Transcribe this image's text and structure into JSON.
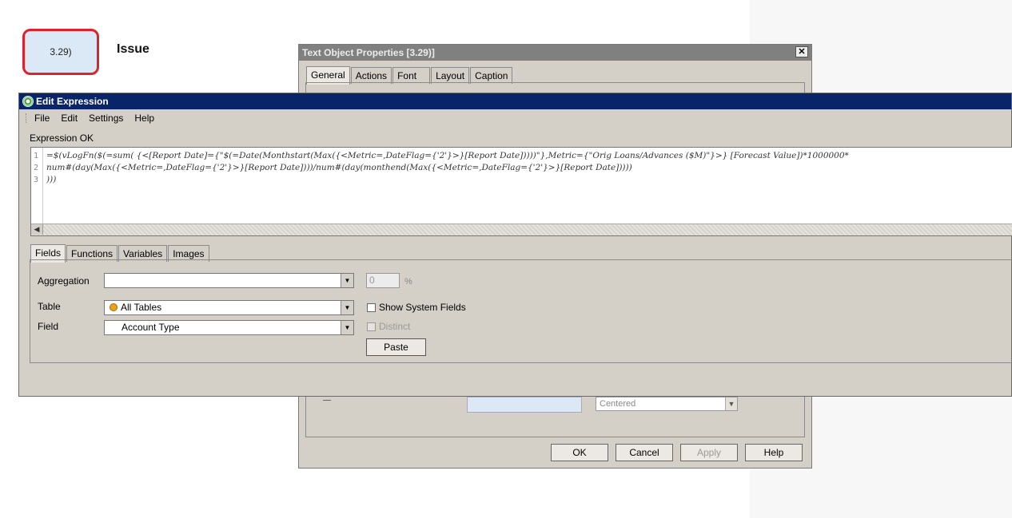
{
  "callout": {
    "label": "3.29)",
    "heading": "Issue"
  },
  "text_props": {
    "title": "Text Object Properties [3.29)]",
    "close": "✕",
    "tabs": [
      "General",
      "Actions",
      "Font",
      "Layout",
      "Caption"
    ],
    "alignment_value": "Centered",
    "buttons": {
      "ok": "OK",
      "cancel": "Cancel",
      "apply": "Apply",
      "help": "Help"
    }
  },
  "edit_expr": {
    "title": "Edit Expression",
    "menu": [
      "File",
      "Edit",
      "Settings",
      "Help"
    ],
    "status": "Expression OK",
    "lines": [
      {
        "num": "1",
        "text": "=$(vLogFn($(=sum( {<[Report Date]={\"$(=Date(Monthstart(Max({<Metric=,DateFlag={'2'}>}[Report Date]))))\"},Metric={\"Orig Loans/Advances ($M)\"}>} [Forecast Value])*1000000*"
      },
      {
        "num": "2",
        "text": "num#(day(Max({<Metric=,DateFlag={'2'}>}[Report Date])))/num#(day(monthend(Max({<Metric=,DateFlag={'2'}>}[Report Date]))))"
      },
      {
        "num": "3",
        "text": ")))"
      }
    ],
    "tabs": [
      "Fields",
      "Functions",
      "Variables",
      "Images"
    ],
    "fields": {
      "aggregation_label": "Aggregation",
      "aggregation_value": "",
      "percent_value": "0",
      "percent_sign": "%",
      "table_label": "Table",
      "table_value": "All Tables",
      "field_label": "Field",
      "field_value": "Account Type",
      "show_system_fields": "Show System Fields",
      "distinct": "Distinct",
      "paste": "Paste"
    }
  }
}
